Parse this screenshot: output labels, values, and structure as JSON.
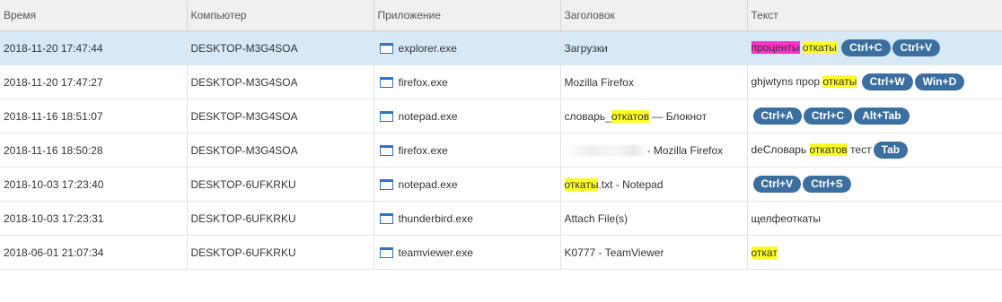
{
  "columns": [
    "Время",
    "Компьютер",
    "Приложение",
    "Заголовок",
    "Текст"
  ],
  "rows": [
    {
      "time": "2018-11-20 17:47:44",
      "computer": "DESKTOP-M3G4SOA",
      "app": "explorer.exe",
      "app_icon": "window-icon",
      "selected": true,
      "title": [
        {
          "t": "Загрузки"
        }
      ],
      "text": [
        {
          "t": "проценты",
          "hl": "magenta"
        },
        {
          "t": " "
        },
        {
          "t": "откаты",
          "hl": "yellow"
        },
        {
          "t": " "
        }
      ],
      "keys": [
        "Ctrl+C",
        "Ctrl+V"
      ]
    },
    {
      "time": "2018-11-20 17:47:27",
      "computer": "DESKTOP-M3G4SOA",
      "app": "firefox.exe",
      "app_icon": "window-icon",
      "title": [
        {
          "t": "Mozilla Firefox"
        }
      ],
      "text": [
        {
          "t": "ghjwtyns прор "
        },
        {
          "t": "откаты",
          "hl": "yellow"
        },
        {
          "t": " "
        }
      ],
      "keys": [
        "Ctrl+W",
        "Win+D"
      ]
    },
    {
      "time": "2018-11-16 18:51:07",
      "computer": "DESKTOP-M3G4SOA",
      "app": "notepad.exe",
      "app_icon": "window-icon",
      "title": [
        {
          "t": "словарь_"
        },
        {
          "t": "откатов",
          "hl": "yellow"
        },
        {
          "t": " — Блокнот"
        }
      ],
      "text": [],
      "keys": [
        "Ctrl+A",
        "Ctrl+C",
        "Alt+Tab"
      ]
    },
    {
      "time": "2018-11-16 18:50:28",
      "computer": "DESKTOP-M3G4SOA",
      "app": "firefox.exe",
      "app_icon": "window-icon",
      "title": [
        {
          "t": "",
          "blur": true
        },
        {
          "t": "- Mozilla Firefox"
        }
      ],
      "text": [
        {
          "t": "deСловарь "
        },
        {
          "t": "откатов",
          "hl": "yellow"
        },
        {
          "t": " тест"
        }
      ],
      "keys": [
        "Tab"
      ]
    },
    {
      "time": "2018-10-03 17:23:40",
      "computer": "DESKTOP-6UFKRKU",
      "app": "notepad.exe",
      "app_icon": "window-icon",
      "title": [
        {
          "t": "откаты",
          "hl": "yellow"
        },
        {
          "t": ".txt - Notepad"
        }
      ],
      "text": [],
      "keys": [
        "Ctrl+V",
        "Ctrl+S"
      ]
    },
    {
      "time": "2018-10-03 17:23:31",
      "computer": "DESKTOP-6UFKRKU",
      "app": "thunderbird.exe",
      "app_icon": "window-icon",
      "title": [
        {
          "t": "Attach File(s)"
        }
      ],
      "text": [
        {
          "t": "щелфеоткаты"
        }
      ],
      "keys": []
    },
    {
      "time": "2018-06-01 21:07:34",
      "computer": "DESKTOP-6UFKRKU",
      "app": "teamviewer.exe",
      "app_icon": "window-icon",
      "title": [
        {
          "t": "K0777 - TeamViewer"
        }
      ],
      "text": [
        {
          "t": "откат",
          "hl": "yellow"
        }
      ],
      "keys": []
    }
  ],
  "colors": {
    "header_bg": "#f0f0f0",
    "selected_row_bg": "#d7e9f7",
    "highlight_yellow": "#ffff26",
    "highlight_magenta": "#ff33cc",
    "key_badge_bg": "#3b6fa0",
    "icon_blue": "#2e72c9"
  }
}
